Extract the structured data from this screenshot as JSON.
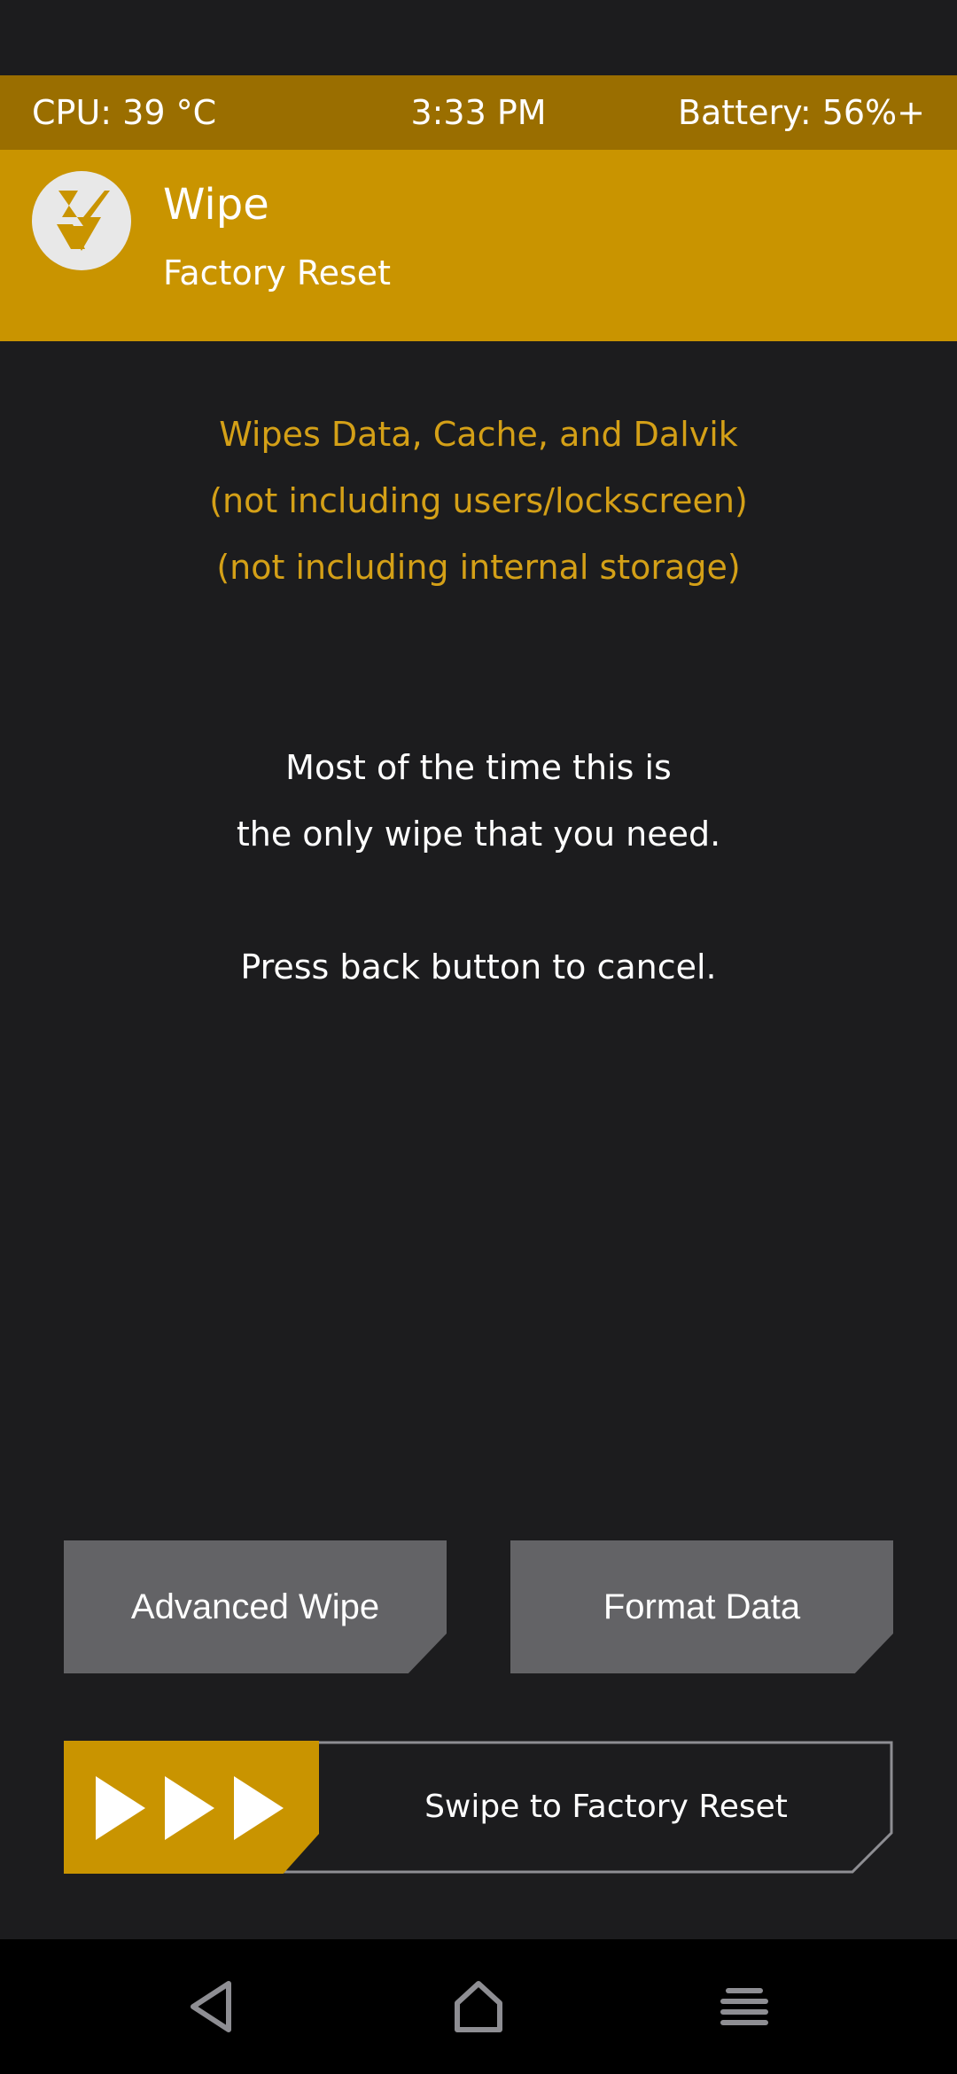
{
  "status": {
    "cpu": "CPU: 39 °C",
    "time": "3:33 PM",
    "battery": "Battery: 56%+"
  },
  "header": {
    "logo_icon": "twrp-logo-icon",
    "title": "Wipe",
    "subtitle": "Factory Reset"
  },
  "info_lines": [
    "Wipes Data, Cache, and Dalvik",
    "(not including users/lockscreen)",
    "(not including internal storage)"
  ],
  "note_lines": [
    "Most of the time this is",
    "the only wipe that you need.",
    "Press back button to cancel."
  ],
  "buttons": {
    "advanced_wipe": "Advanced Wipe",
    "format_data": "Format Data"
  },
  "swipe": {
    "label": "Swipe to Factory Reset",
    "handle_icon": "triple-arrow-icon"
  },
  "nav": {
    "back_icon": "back-triangle-icon",
    "home_icon": "home-icon",
    "menu_icon": "menu-icon"
  },
  "colors": {
    "accent": "#c99400",
    "statusbar": "#9a6e00",
    "background": "#1c1c1e",
    "button": "#636366",
    "info_text": "#d4a017"
  }
}
